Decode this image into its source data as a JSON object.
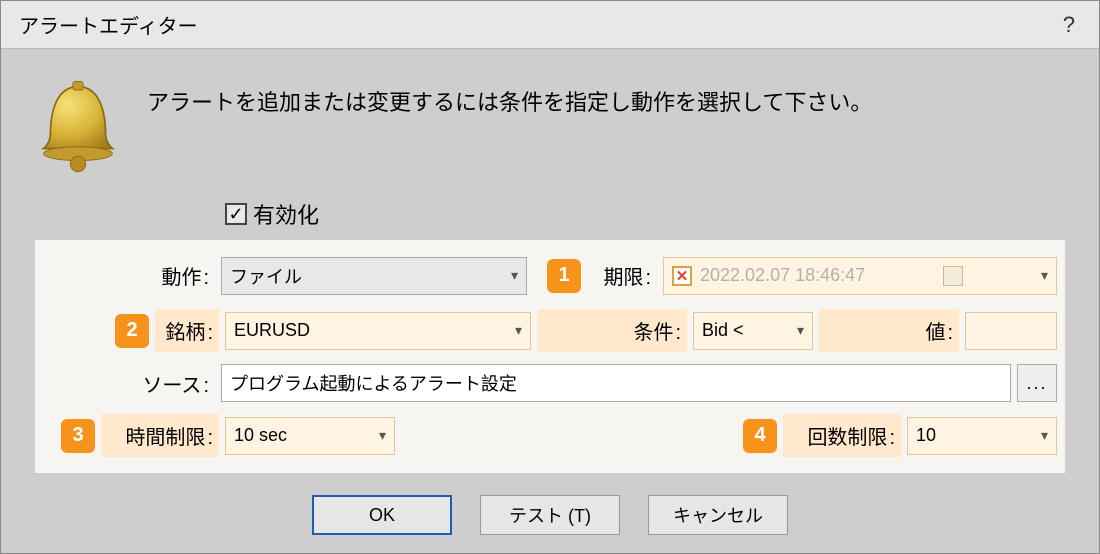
{
  "window": {
    "title": "アラートエディター",
    "help": "?"
  },
  "instruction": "アラートを追加または変更するには条件を指定し動作を選択して下さい。",
  "enable": {
    "label": "有効化",
    "checked": true
  },
  "badges": {
    "b1": "1",
    "b2": "2",
    "b3": "3",
    "b4": "4"
  },
  "labels": {
    "action": "動作",
    "expiration": "期限",
    "symbol": "銘柄",
    "condition": "条件",
    "value": "値",
    "source": "ソース",
    "timeout": "時間制限",
    "maxiter": "回数制限"
  },
  "fields": {
    "action": "ファイル",
    "expiration": "2022.02.07 18:46:47",
    "symbol": "EURUSD",
    "condition": "Bid <",
    "value": "",
    "source": "プログラム起動によるアラート設定",
    "timeout": "10 sec",
    "maxiter": "10"
  },
  "buttons": {
    "ok": "OK",
    "test": "テスト (T)",
    "cancel": "キャンセル",
    "browse": "..."
  }
}
